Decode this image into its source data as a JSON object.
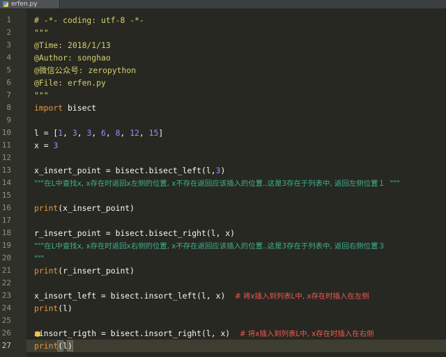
{
  "tab": {
    "filename": "erfen.py"
  },
  "line_numbers": [
    "1",
    "2",
    "3",
    "4",
    "5",
    "6",
    "7",
    "8",
    "9",
    "10",
    "11",
    "12",
    "13",
    "14",
    "15",
    "16",
    "17",
    "18",
    "19",
    "20",
    "21",
    "22",
    "23",
    "24",
    "25",
    "26",
    "27"
  ],
  "lines": [
    [
      {
        "t": "comment",
        "v": "# -*- coding: utf-8 -*-"
      }
    ],
    [
      {
        "t": "comment",
        "v": "\"\"\""
      }
    ],
    [
      {
        "t": "comment",
        "v": "@Time: 2018/1/13"
      }
    ],
    [
      {
        "t": "comment",
        "v": "@Author: songhao"
      }
    ],
    [
      {
        "t": "comment",
        "v": "@微信公众号: zeropython"
      }
    ],
    [
      {
        "t": "comment",
        "v": "@File: erfen.py"
      }
    ],
    [
      {
        "t": "comment",
        "v": "\"\"\""
      }
    ],
    [
      {
        "t": "kw",
        "v": "import"
      },
      {
        "t": "plain",
        "v": " bisect"
      }
    ],
    [],
    [
      {
        "t": "plain",
        "v": "l = ["
      },
      {
        "t": "number",
        "v": "1"
      },
      {
        "t": "plain",
        "v": ", "
      },
      {
        "t": "number",
        "v": "3"
      },
      {
        "t": "plain",
        "v": ", "
      },
      {
        "t": "number",
        "v": "3"
      },
      {
        "t": "plain",
        "v": ", "
      },
      {
        "t": "number",
        "v": "6"
      },
      {
        "t": "plain",
        "v": ", "
      },
      {
        "t": "number",
        "v": "8"
      },
      {
        "t": "plain",
        "v": ", "
      },
      {
        "t": "number",
        "v": "12"
      },
      {
        "t": "plain",
        "v": ", "
      },
      {
        "t": "number",
        "v": "15"
      },
      {
        "t": "plain",
        "v": "]"
      }
    ],
    [
      {
        "t": "plain",
        "v": "x = "
      },
      {
        "t": "number",
        "v": "3"
      }
    ],
    [],
    [
      {
        "t": "plain",
        "v": "x_insert_point = bisect.bisect_left(l,"
      },
      {
        "t": "number",
        "v": "3"
      },
      {
        "t": "plain",
        "v": ")"
      }
    ],
    [
      {
        "t": "docstring",
        "v": "\"\"\"在L中查找x, x存在时返回x左侧的位置, x不存在返回应该插入的位置..这是3存在于列表中, 返回左侧位置１  \"\"\""
      }
    ],
    [],
    [
      {
        "t": "kw",
        "v": "print"
      },
      {
        "t": "plain",
        "v": "(x_insert_point)"
      }
    ],
    [],
    [
      {
        "t": "plain",
        "v": "r_insert_point = bisect.bisect_right(l, x)"
      }
    ],
    [
      {
        "t": "docstring",
        "v": "\"\"\"在L中查找x, x存在时返回x右侧的位置, x不存在返回应该插入的位置..这是3存在于列表中, 返回右侧位置３"
      }
    ],
    [
      {
        "t": "docstring",
        "v": "\"\"\""
      }
    ],
    [
      {
        "t": "kw",
        "v": "print"
      },
      {
        "t": "plain",
        "v": "(r_insert_point)"
      }
    ],
    [],
    [
      {
        "t": "plain",
        "v": "x_insort_left = bisect.insort_left(l, x)  "
      },
      {
        "t": "hash",
        "v": "# 将x插入到列表L中, x存在时插入在左侧"
      }
    ],
    [
      {
        "t": "kw",
        "v": "print"
      },
      {
        "t": "plain",
        "v": "(l)"
      }
    ],
    [],
    [
      {
        "t": "plain",
        "v": "x"
      },
      {
        "t": "bulb",
        "v": ""
      },
      {
        "t": "plain",
        "v": "insort_rigth = bisect.insort_right(l, x)  "
      },
      {
        "t": "hash",
        "v": "# 将x插入到列表L中, x存在时插入在右侧"
      }
    ],
    [
      {
        "t": "kw",
        "v": "print"
      },
      {
        "t": "paren",
        "v": "("
      },
      {
        "t": "plain",
        "v": "l"
      },
      {
        "t": "paren",
        "v": ")"
      },
      {
        "t": "caret",
        "v": ""
      }
    ]
  ],
  "current_line": 27,
  "colors": {
    "background": "#272822",
    "gutter": "#2f3129",
    "current_row": "#3e3d32",
    "comment": "#d6d06e",
    "keyword": "#e69642",
    "number": "#ae81ff",
    "docstring": "#3fb28f",
    "inline_comment": "#f05a52"
  }
}
